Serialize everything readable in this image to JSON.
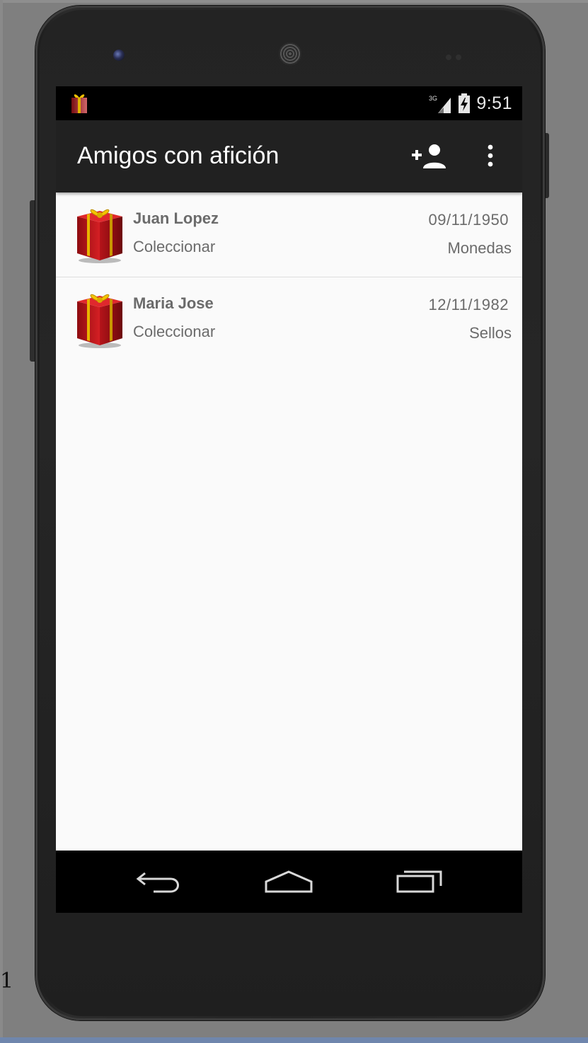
{
  "status_bar": {
    "network": "3G",
    "time": "9:51"
  },
  "app_bar": {
    "title": "Amigos con afición",
    "actions": [
      "add-person-icon",
      "more-vert-icon"
    ]
  },
  "friends": [
    {
      "name": "Juan Lopez",
      "hobby": "Coleccionar",
      "date": "09/11/1950",
      "item": "Monedas",
      "icon": "gift-icon"
    },
    {
      "name": "Maria Jose",
      "hobby": "Coleccionar",
      "date": "12/11/1982",
      "item": "Sellos",
      "icon": "gift-icon"
    }
  ],
  "nav_bar": [
    "back-icon",
    "home-icon",
    "recents-icon"
  ],
  "stray_text": "1",
  "colors": {
    "app_bar": "#212121",
    "status_bar": "#000000",
    "list_background": "#fafafa",
    "list_text": "#6b6b6b",
    "gift_red": "#c4161c",
    "gift_ribbon": "#f2c200"
  }
}
